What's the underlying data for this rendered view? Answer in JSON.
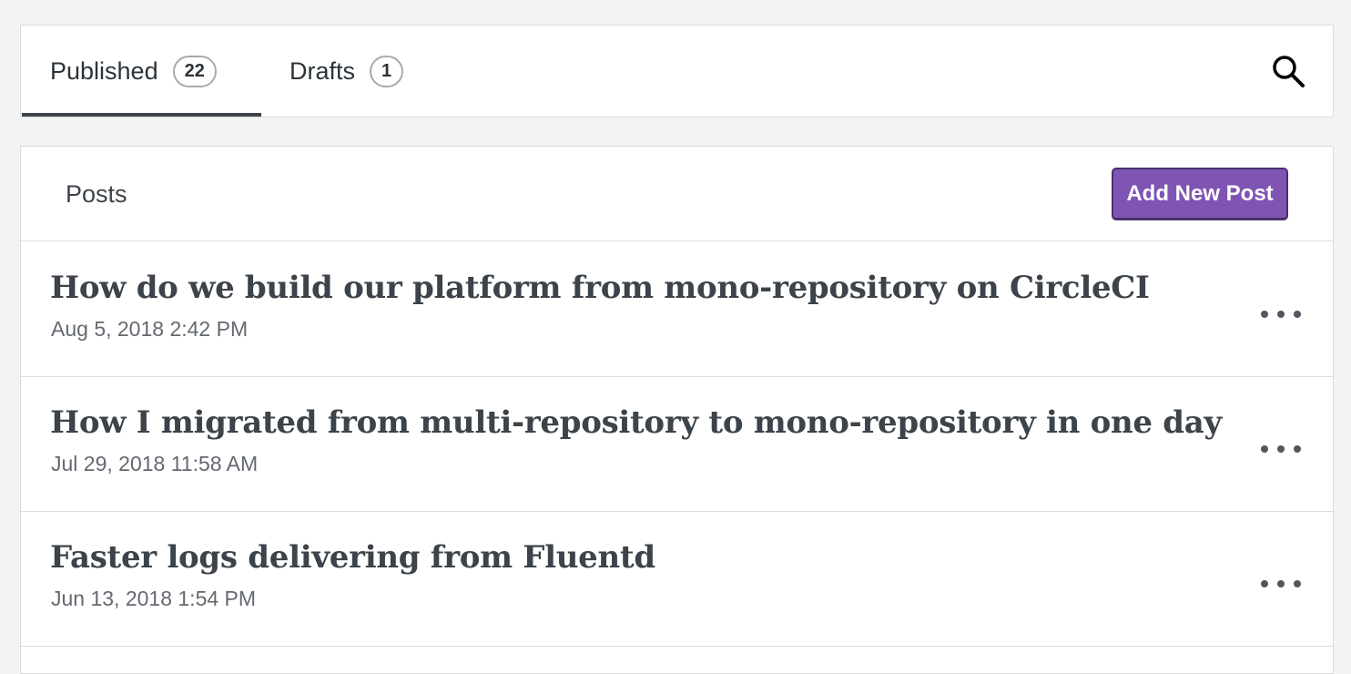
{
  "tabs": [
    {
      "label": "Published",
      "count": "22"
    },
    {
      "label": "Drafts",
      "count": "1"
    }
  ],
  "list": {
    "title": "Posts",
    "add_button": "Add New Post"
  },
  "posts": [
    {
      "title": "How do we build our platform from mono-repository on CircleCI",
      "date": "Aug 5, 2018 2:42 PM"
    },
    {
      "title": "How I migrated from multi-repository to mono-repository in one day",
      "date": "Jul 29, 2018 11:58 AM"
    },
    {
      "title": "Faster logs delivering from Fluentd",
      "date": "Jun 13, 2018 1:54 PM"
    }
  ],
  "icons": {
    "search": "search-icon",
    "more": "ellipsis-icon"
  },
  "colors": {
    "accent": "#7f54b3",
    "accent_border": "#4a2f6e",
    "background": "#f3f3f3"
  }
}
